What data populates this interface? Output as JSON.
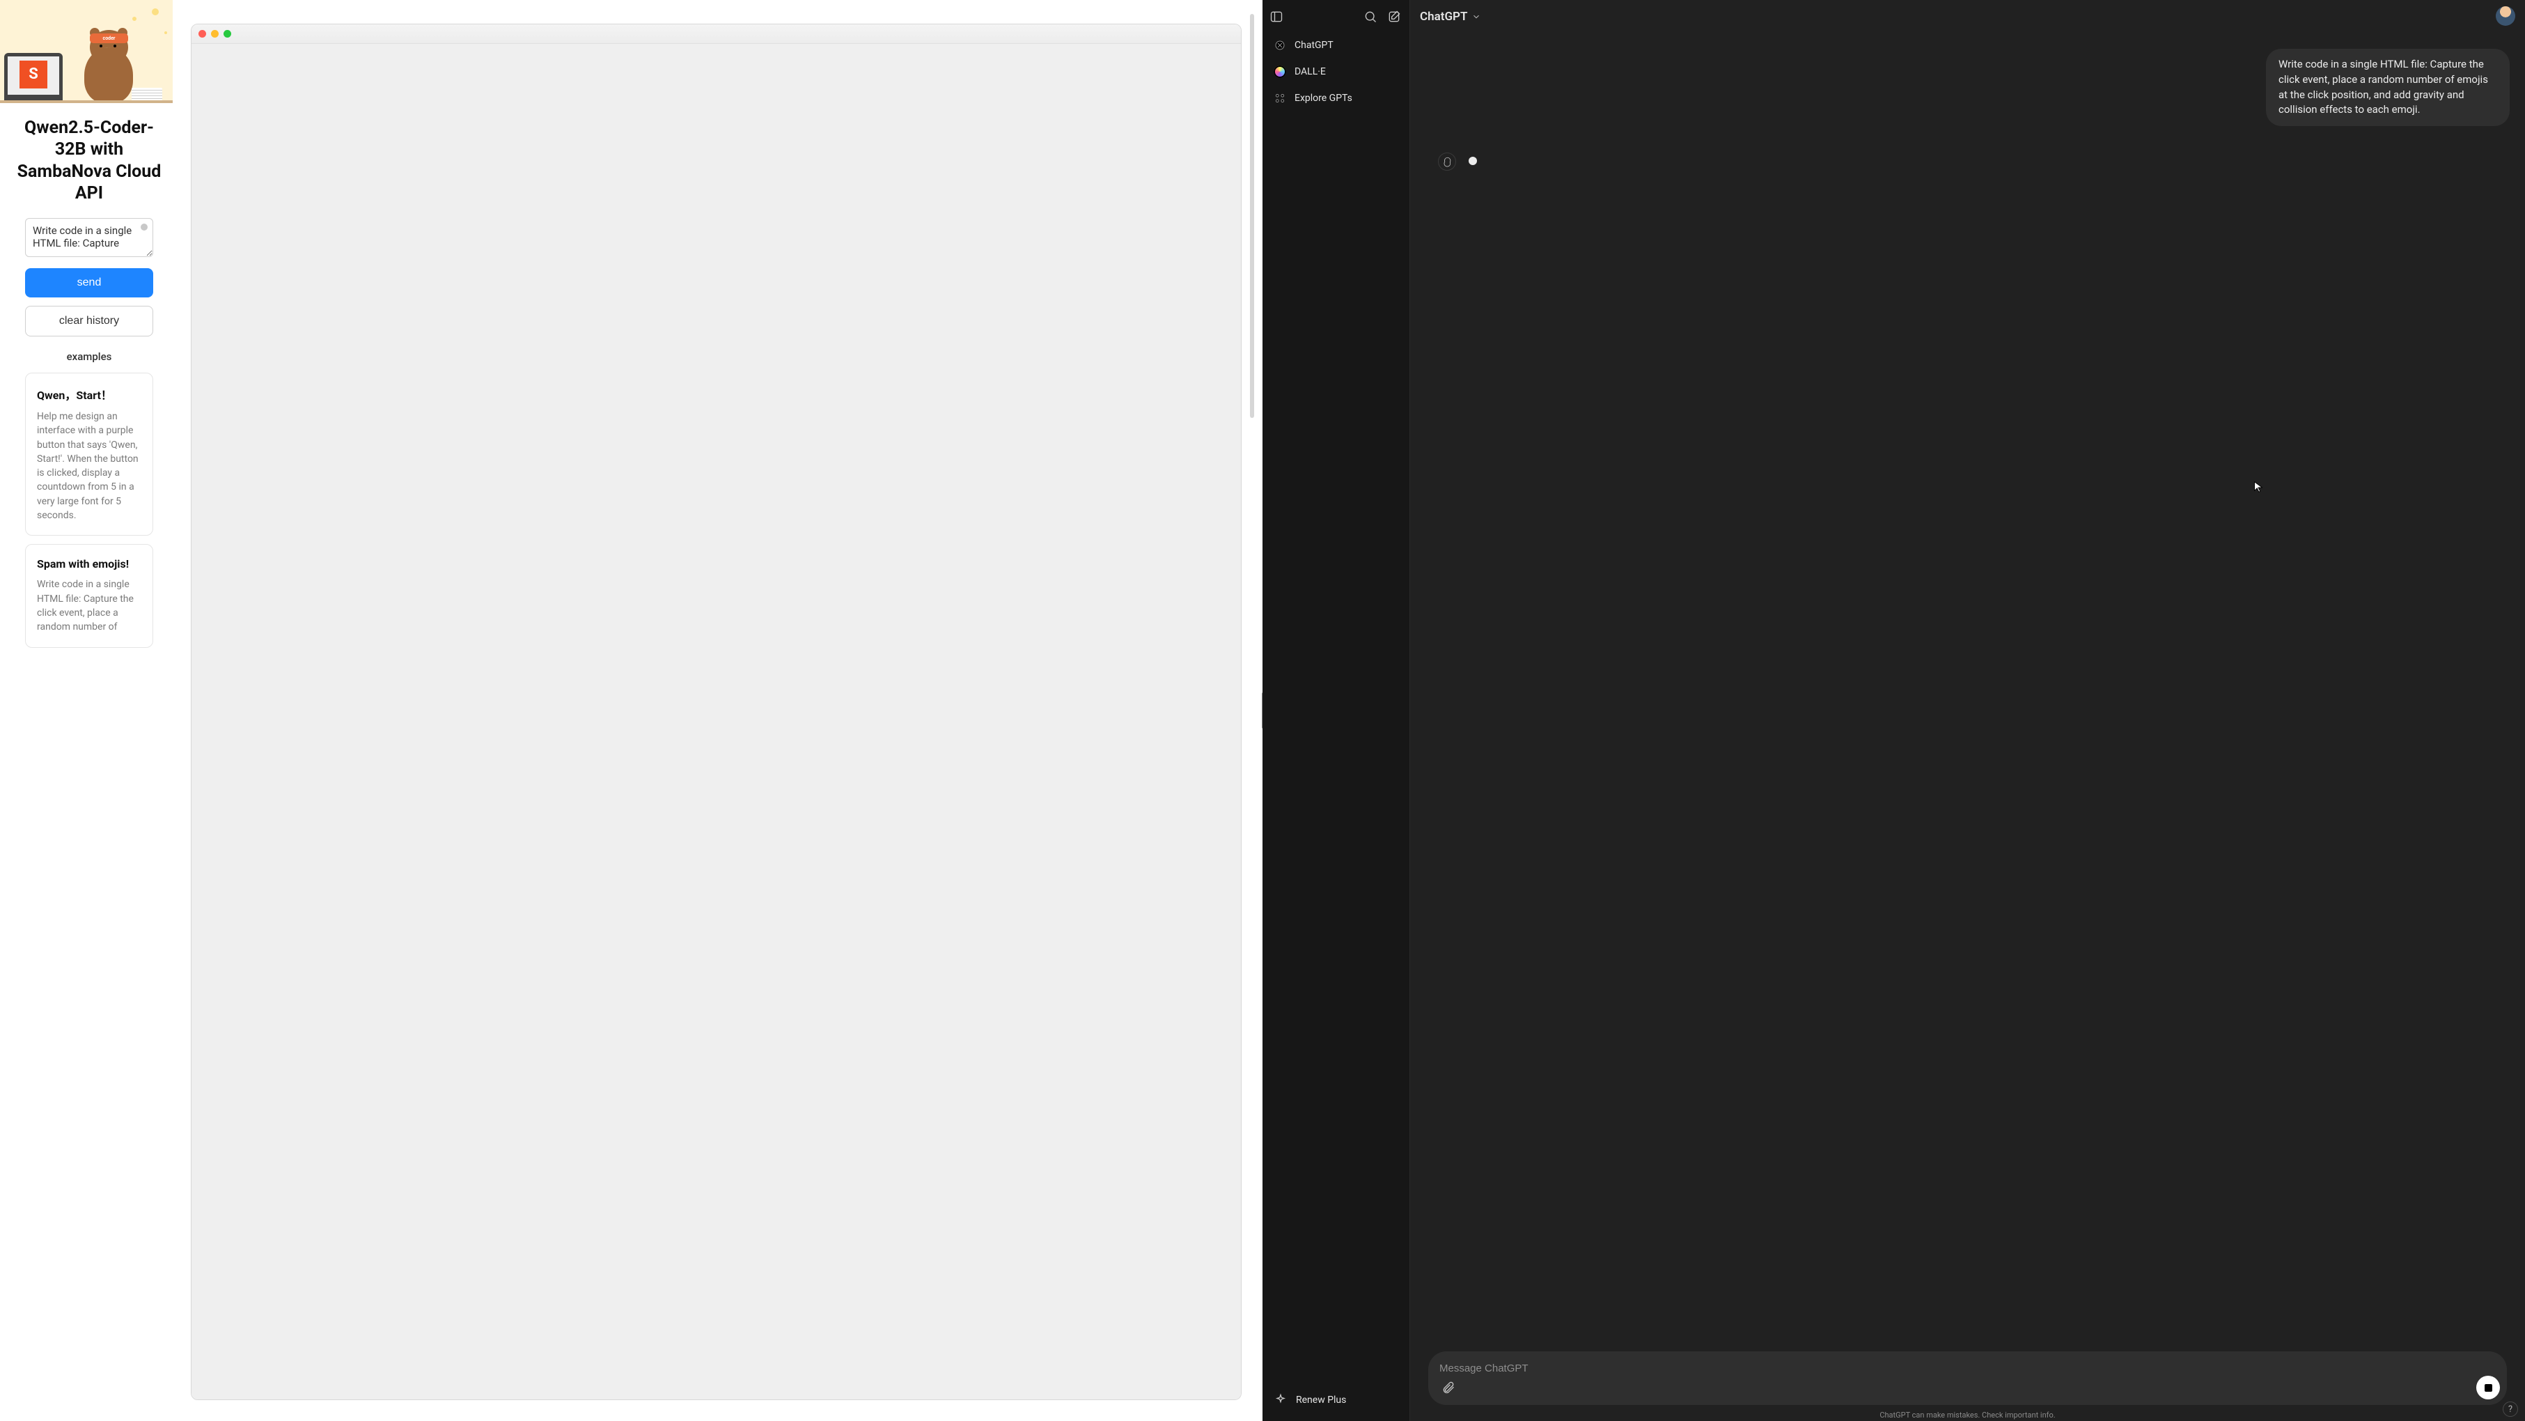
{
  "left": {
    "hero_band": "coder",
    "title": "Qwen2.5-Coder-32B with SambaNova Cloud API",
    "textarea_value": "Write code in a single HTML file: Capture",
    "send_label": "send",
    "clear_label": "clear history",
    "examples_label": "examples",
    "examples": [
      {
        "title": "Qwen，Start！",
        "desc": "Help me design an interface with a purple button that says 'Qwen, Start!'. When the button is clicked, display a countdown from 5 in a very large font for 5 seconds."
      },
      {
        "title": "Spam with emojis!",
        "desc": "Write code in a single HTML file: Capture the click event, place a random number of"
      }
    ]
  },
  "right": {
    "sidebar": {
      "items": [
        {
          "label": "ChatGPT"
        },
        {
          "label": "DALL·E"
        },
        {
          "label": "Explore GPTs"
        }
      ],
      "renew_label": "Renew Plus"
    },
    "header": {
      "model_label": "ChatGPT"
    },
    "thread": {
      "user_message": "Write code in a single HTML file: Capture the click event, place a random number of emojis at the click position, and add gravity and collision effects to each emoji."
    },
    "composer": {
      "placeholder": "Message ChatGPT"
    },
    "disclaimer": "ChatGPT can make mistakes. Check important info.",
    "help_label": "?"
  }
}
